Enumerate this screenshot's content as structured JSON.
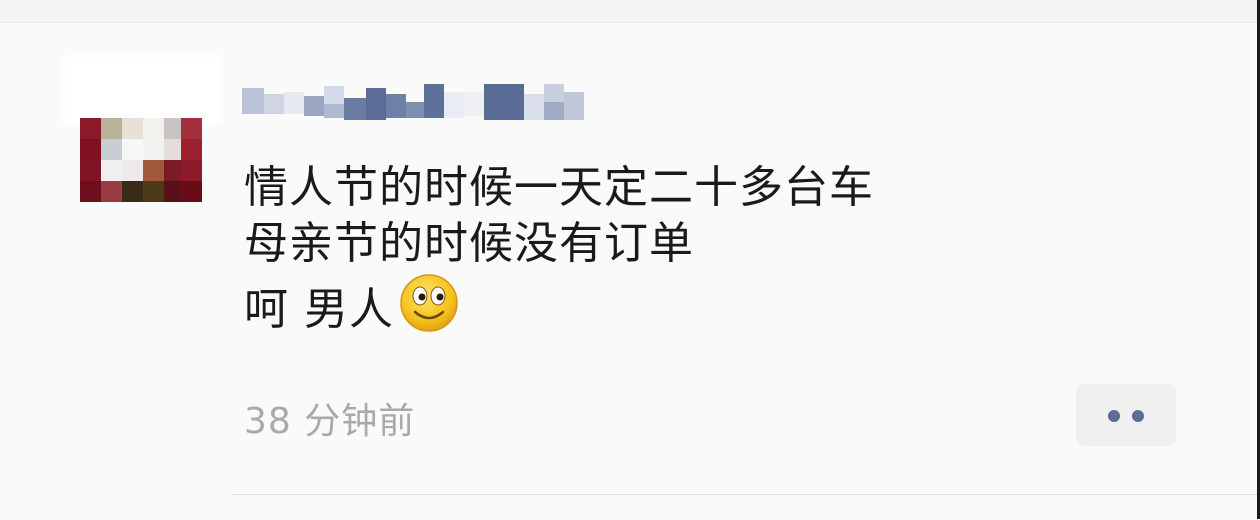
{
  "post": {
    "lines": [
      "情人节的时候一天定二十多台车",
      "母亲节的时候没有订单",
      "呵 男人"
    ],
    "emoji_icon": "smiley-face-icon",
    "timestamp": "38 分钟前"
  },
  "actions": {
    "more_icon": "more-dots-icon"
  },
  "colors": {
    "text": "#1a1a1a",
    "timestamp": "#a9a9a9",
    "dots": "#5b6d95",
    "button_bg": "#f0f0f0",
    "background": "#fafafa"
  }
}
